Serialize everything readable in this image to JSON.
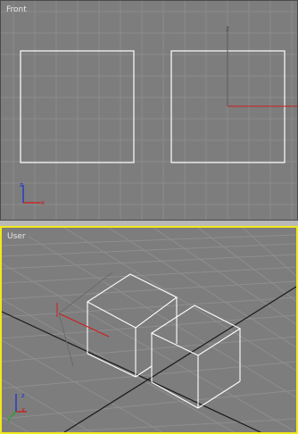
{
  "viewports": {
    "front": {
      "label": "Front"
    },
    "user": {
      "label": "User"
    }
  },
  "colors": {
    "background": "#7d7d7d",
    "grid": "#8c8c8c",
    "objects": "#ffffff",
    "active_border": "#f2e81a",
    "axis_x": "#d11a1a",
    "axis_y": "#1aa51a",
    "axis_z": "#1a33d1"
  },
  "axis_gizmo": {
    "x": "x",
    "y": "y",
    "z": "z"
  }
}
